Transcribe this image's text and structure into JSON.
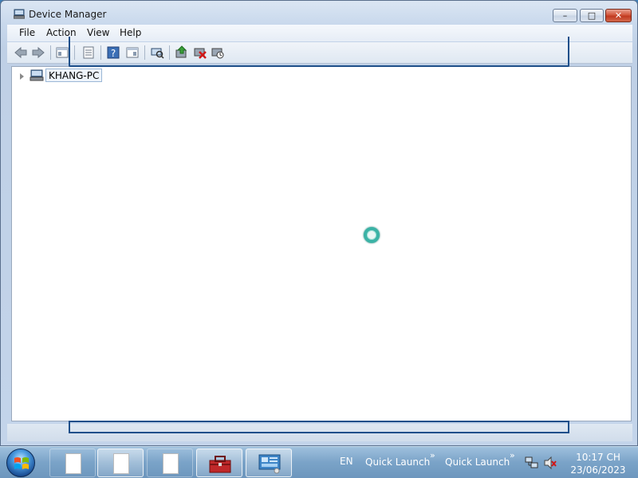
{
  "window": {
    "title": "Device Manager",
    "caption_buttons": {
      "minimize": "–",
      "maximize": "□",
      "close": "✕"
    }
  },
  "menu": {
    "items": [
      {
        "label": "File"
      },
      {
        "label": "Action"
      },
      {
        "label": "View"
      },
      {
        "label": "Help"
      }
    ]
  },
  "toolbar": {
    "buttons": [
      "back-icon",
      "forward-icon",
      "show-hide-console-tree-icon",
      "properties-icon",
      "help-icon",
      "show-action-pane-icon",
      "scan-hardware-icon",
      "update-driver-icon",
      "uninstall-icon",
      "disable-device-icon"
    ]
  },
  "tree": {
    "root_label": "KHANG-PC"
  },
  "taskbar": {
    "language": "EN",
    "quick_launch_1": "Quick Launch",
    "quick_launch_2": "Quick Launch",
    "chevron": "»",
    "time": "10:17 CH",
    "date": "23/06/2023"
  },
  "colors": {
    "accent": "#1e4f8a",
    "close_button": "#c03a20",
    "spinner": "#3bb3a6"
  }
}
